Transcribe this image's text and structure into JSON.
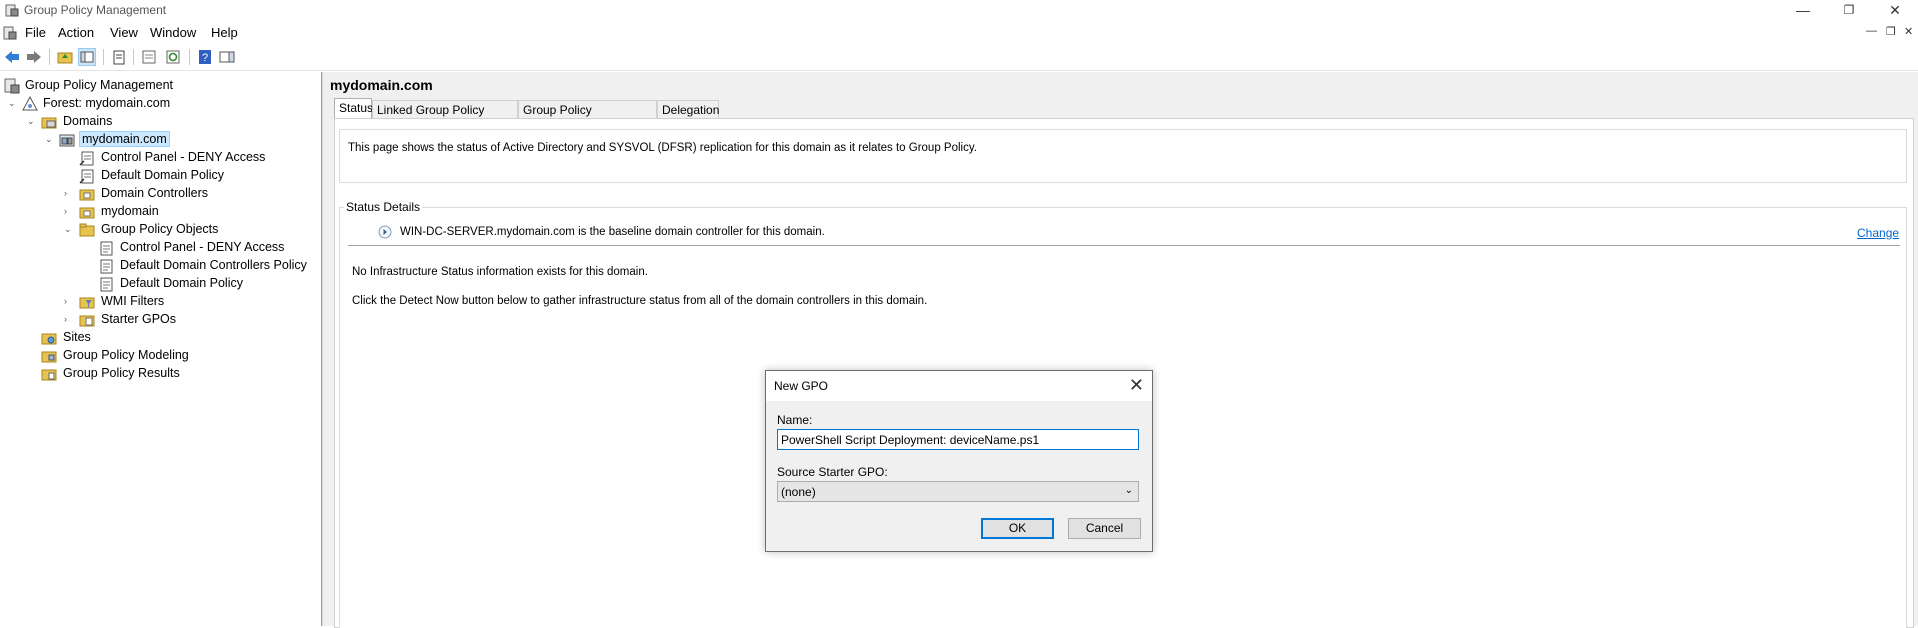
{
  "window": {
    "title": "Group Policy Management",
    "controls": [
      "minimize",
      "restore",
      "close"
    ]
  },
  "menu": {
    "items": [
      "File",
      "Action",
      "View",
      "Window",
      "Help"
    ]
  },
  "tree": {
    "root": "Group Policy Management",
    "forest": "Forest: mydomain.com",
    "domains": "Domains",
    "domain": "mydomain.com",
    "domain_children": [
      "Control Panel - DENY Access",
      "Default Domain Policy",
      "Domain Controllers",
      "mydomain"
    ],
    "gpo_folder": "Group Policy Objects",
    "gpo_children": [
      "Control Panel - DENY Access",
      "Default Domain Controllers Policy",
      "Default Domain Policy"
    ],
    "wmi": "WMI Filters",
    "starter": "Starter GPOs",
    "sites": "Sites",
    "modeling": "Group Policy Modeling",
    "results": "Group Policy Results"
  },
  "content": {
    "header": "mydomain.com",
    "tabs": [
      "Status",
      "Linked Group Policy Objects",
      "Group Policy Inheritance",
      "Delegation"
    ],
    "active_tab": "Status",
    "intro": "This page shows the status of Active Directory and SYSVOL (DFSR) replication for this domain as it relates to Group Policy.",
    "status_details_title": "Status Details",
    "baseline_text": "WIN-DC-SERVER.mydomain.com is the baseline domain controller for this domain.",
    "change_link": "Change",
    "no_info": "No Infrastructure Status information exists for this domain.",
    "detect_hint": "Click the Detect Now button below to gather infrastructure status from all of the domain controllers in this domain."
  },
  "dialog": {
    "title": "New GPO",
    "name_label": "Name:",
    "name_value": "PowerShell Script Deployment: deviceName.ps1",
    "starter_label": "Source Starter GPO:",
    "starter_value": "(none)",
    "ok": "OK",
    "cancel": "Cancel"
  }
}
